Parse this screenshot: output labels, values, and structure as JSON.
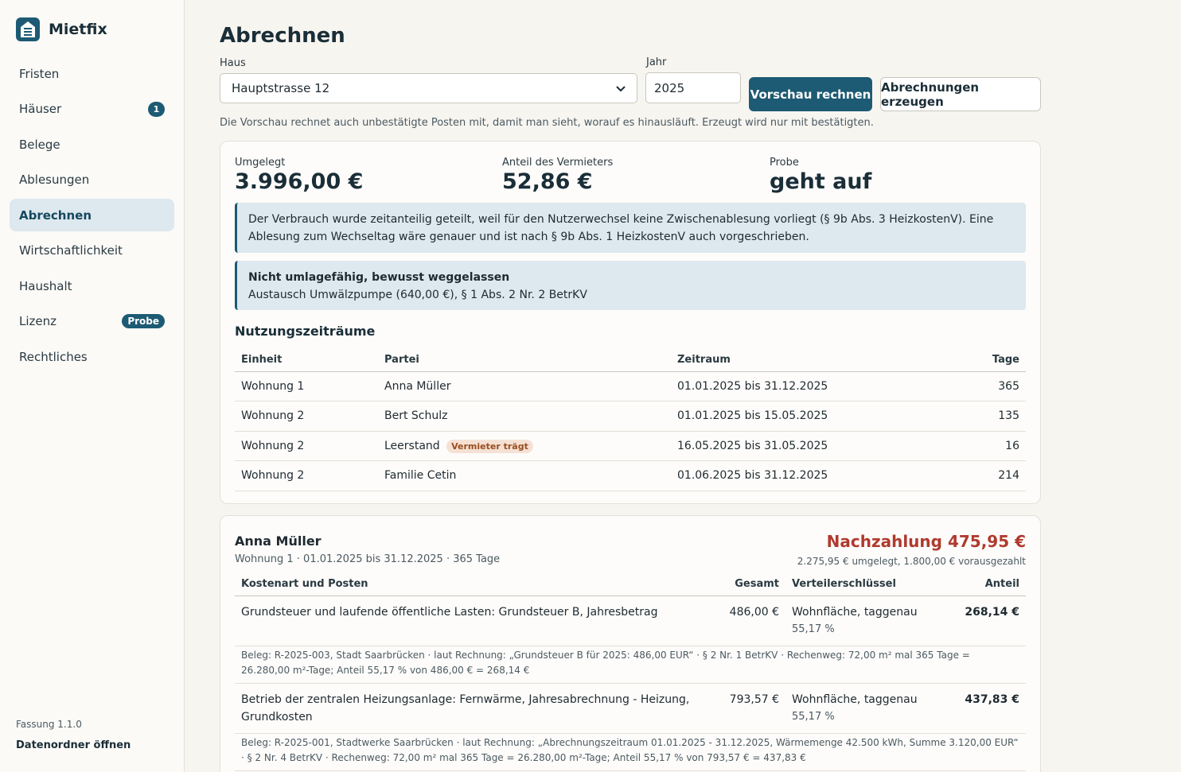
{
  "brand": {
    "name": "Mietfix"
  },
  "nav": {
    "items": [
      {
        "label": "Fristen"
      },
      {
        "label": "Häuser",
        "badge": "1"
      },
      {
        "label": "Belege"
      },
      {
        "label": "Ablesungen"
      },
      {
        "label": "Abrechnen",
        "active": true
      },
      {
        "label": "Wirtschaftlichkeit"
      },
      {
        "label": "Haushalt"
      },
      {
        "label": "Lizenz",
        "badge": "Probe"
      },
      {
        "label": "Rechtliches"
      }
    ]
  },
  "footer": {
    "version": "Fassung 1.1.0",
    "open_folder": "Datenordner öffnen"
  },
  "page": {
    "title": "Abrechnen",
    "haus_label": "Haus",
    "haus_value": "Hauptstrasse 12",
    "jahr_label": "Jahr",
    "jahr_value": "2025",
    "preview_button": "Vorschau rechnen",
    "generate_button": "Abrechnungen erzeugen",
    "hint": "Die Vorschau rechnet auch unbestätigte Posten mit, damit man sieht, worauf es hinausläuft. Erzeugt wird nur mit bestätigten."
  },
  "summary": {
    "umgelegt_label": "Umgelegt",
    "umgelegt_value": "3.996,00 €",
    "vermieter_label": "Anteil des Vermieters",
    "vermieter_value": "52,86 €",
    "probe_label": "Probe",
    "probe_value": "geht auf",
    "notice_verbrauch": "Der Verbrauch wurde zeitanteilig geteilt, weil für den Nutzerwechsel keine Zwischenablesung vorliegt (§ 9b Abs. 3 HeizkostenV). Eine Ablesung zum Wechseltag wäre genauer und ist nach § 9b Abs. 1 HeizkostenV auch vorgeschrieben.",
    "notice_title": "Nicht umlagefähig, bewusst weggelassen",
    "notice_text": "Austausch Umwälzpumpe (640,00 €), § 1 Abs. 2 Nr. 2 BetrKV"
  },
  "periods": {
    "title": "Nutzungszeiträume",
    "headers": {
      "einheit": "Einheit",
      "partei": "Partei",
      "zeitraum": "Zeitraum",
      "tage": "Tage"
    },
    "rows": [
      {
        "einheit": "Wohnung 1",
        "partei": "Anna Müller",
        "zeitraum": "01.01.2025 bis 31.12.2025",
        "tage": "365"
      },
      {
        "einheit": "Wohnung 2",
        "partei": "Bert Schulz",
        "zeitraum": "01.01.2025 bis 15.05.2025",
        "tage": "135"
      },
      {
        "einheit": "Wohnung 2",
        "partei": "Leerstand",
        "tag": "Vermieter trägt",
        "zeitraum": "16.05.2025 bis 31.05.2025",
        "tage": "16"
      },
      {
        "einheit": "Wohnung 2",
        "partei": "Familie Cetin",
        "zeitraum": "01.06.2025 bis 31.12.2025",
        "tage": "214"
      }
    ]
  },
  "party": {
    "name": "Anna Müller",
    "sub": "Wohnung 1 · 01.01.2025 bis 31.12.2025 · 365 Tage",
    "amount": "Nachzahlung 475,95 €",
    "detail": "2.275,95 € umgelegt, 1.800,00 € vorausgezahlt",
    "headers": {
      "kostenart": "Kostenart und Posten",
      "gesamt": "Gesamt",
      "schluessel": "Verteilerschlüssel",
      "anteil": "Anteil"
    },
    "rows": [
      {
        "kostenart": "Grundsteuer und laufende öffentliche Lasten: Grundsteuer B, Jahresbetrag",
        "gesamt": "486,00 €",
        "schluessel": "Wohnfläche, taggenau",
        "prozent": "55,17 %",
        "anteil": "268,14 €",
        "beleg": "Beleg: R-2025-003, Stadt Saarbrücken · laut Rechnung: „Grundsteuer B für 2025: 486,00 EUR“ · § 2 Nr. 1 BetrKV · Rechenweg: 72,00 m² mal 365 Tage = 26.280,00 m²-Tage; Anteil 55,17 % von 486,00 € = 268,14 €"
      },
      {
        "kostenart": "Betrieb der zentralen Heizungsanlage: Fernwärme, Jahresabrechnung - Heizung, Grundkosten",
        "gesamt": "793,57 €",
        "schluessel": "Wohnfläche, taggenau",
        "prozent": "55,17 %",
        "anteil": "437,83 €",
        "beleg": "Beleg: R-2025-001, Stadtwerke Saarbrücken · laut Rechnung: „Abrechnungszeitraum 01.01.2025 - 31.12.2025, Wärmemenge 42.500 kWh, Summe 3.120,00 EUR“ · § 2 Nr. 4 BetrKV · Rechenweg: 72,00 m² mal 365 Tage = 26.280,00 m²-Tage; Anteil 55,17 % von 793,57 € = 437,83 €"
      }
    ]
  }
}
